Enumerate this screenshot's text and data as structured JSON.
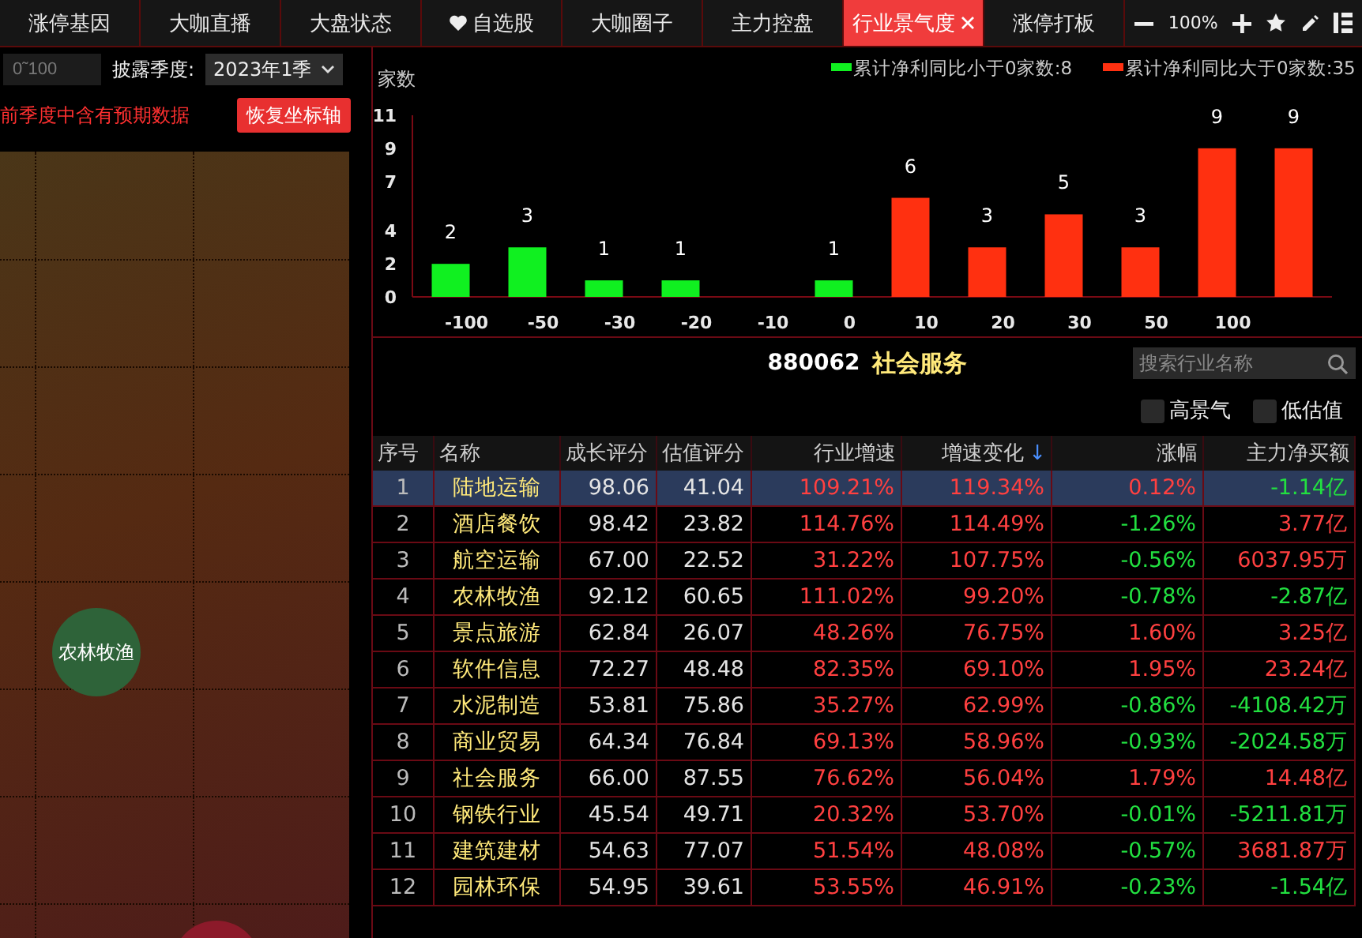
{
  "tabs": [
    {
      "label": "涨停基因",
      "selected": false,
      "kind": "plain",
      "closable": false
    },
    {
      "label": "大咖直播",
      "selected": false,
      "kind": "plain",
      "closable": false
    },
    {
      "label": "大盘状态",
      "selected": false,
      "kind": "plain",
      "closable": false
    },
    {
      "label": "自选股",
      "selected": false,
      "kind": "favorites",
      "closable": false
    },
    {
      "label": "大咖圈子",
      "selected": false,
      "kind": "plain",
      "closable": false
    },
    {
      "label": "主力控盘",
      "selected": false,
      "kind": "plain",
      "closable": false
    },
    {
      "label": "行业景气度",
      "selected": true,
      "kind": "plain",
      "closable": true
    },
    {
      "label": "涨停打板",
      "selected": false,
      "kind": "plain",
      "closable": false
    }
  ],
  "toolbar": {
    "zoom_level": "100%"
  },
  "left_panel": {
    "range_field": {
      "placeholder": "0˜100"
    },
    "quarter_label": "披露季度:",
    "quarter_select": {
      "value": "2023年1季"
    },
    "notice": "前季度中含有预期数据",
    "reset_button": "恢复坐标轴",
    "bubbles": [
      {
        "label": "农林牧渔",
        "color": "#2e6339"
      },
      {
        "color": "#8c1a2a"
      }
    ]
  },
  "chart": {
    "chart_data": {
      "type": "bar",
      "ylabel": "家数",
      "legend": "upper right",
      "data_labels": true,
      "categories": [
        "-100",
        "-50",
        "-30",
        "-20",
        "-10",
        "0",
        "10",
        "20",
        "30",
        "50",
        "100",
        null
      ],
      "ylim": [
        0,
        11
      ],
      "yticks": [
        0,
        2,
        4,
        7,
        9,
        11
      ],
      "series": [
        {
          "name": "累计净利同比小于0家数:8",
          "color": "#10f020",
          "values": [
            2,
            3,
            1,
            1,
            null,
            1,
            null,
            null,
            null,
            null,
            null,
            null
          ]
        },
        {
          "name": "累计净利同比大于0家数:35",
          "color": "#ff3010",
          "values": [
            null,
            null,
            null,
            null,
            null,
            null,
            6,
            3,
            5,
            3,
            9,
            9
          ]
        }
      ]
    }
  },
  "industry": {
    "code": "880062",
    "name": "社会服务"
  },
  "search": {
    "placeholder": "搜索行业名称"
  },
  "filters": [
    {
      "label": "高景气",
      "checked": false
    },
    {
      "label": "低估值",
      "checked": false
    }
  ],
  "table": {
    "columns": [
      {
        "label": "序号"
      },
      {
        "label": "名称"
      },
      {
        "label": "成长评分"
      },
      {
        "label": "估值评分"
      },
      {
        "label": "行业增速"
      },
      {
        "label": "增速变化",
        "sort_arrow": "↓"
      },
      {
        "label": "涨幅"
      },
      {
        "label": "主力净买额"
      }
    ],
    "rows": [
      {
        "rank": "1",
        "name": "陆地运输",
        "growth": "98.06",
        "valuation": "41.04",
        "industry_growth": "109.21%",
        "growth_change": "119.34%",
        "change": {
          "value": "0.12%",
          "up": true
        },
        "net_buy": {
          "value": "-1.14亿",
          "up": false
        },
        "selected": true
      },
      {
        "rank": "2",
        "name": "酒店餐饮",
        "growth": "98.42",
        "valuation": "23.82",
        "industry_growth": "114.76%",
        "growth_change": "114.49%",
        "change": {
          "value": "-1.26%",
          "up": false
        },
        "net_buy": {
          "value": "3.77亿",
          "up": true
        },
        "selected": false
      },
      {
        "rank": "3",
        "name": "航空运输",
        "growth": "67.00",
        "valuation": "22.52",
        "industry_growth": "31.22%",
        "growth_change": "107.75%",
        "change": {
          "value": "-0.56%",
          "up": false
        },
        "net_buy": {
          "value": "6037.95万",
          "up": true
        },
        "selected": false
      },
      {
        "rank": "4",
        "name": "农林牧渔",
        "growth": "92.12",
        "valuation": "60.65",
        "industry_growth": "111.02%",
        "growth_change": "99.20%",
        "change": {
          "value": "-0.78%",
          "up": false
        },
        "net_buy": {
          "value": "-2.87亿",
          "up": false
        },
        "selected": false
      },
      {
        "rank": "5",
        "name": "景点旅游",
        "growth": "62.84",
        "valuation": "26.07",
        "industry_growth": "48.26%",
        "growth_change": "76.75%",
        "change": {
          "value": "1.60%",
          "up": true
        },
        "net_buy": {
          "value": "3.25亿",
          "up": true
        },
        "selected": false
      },
      {
        "rank": "6",
        "name": "软件信息",
        "growth": "72.27",
        "valuation": "48.48",
        "industry_growth": "82.35%",
        "growth_change": "69.10%",
        "change": {
          "value": "1.95%",
          "up": true
        },
        "net_buy": {
          "value": "23.24亿",
          "up": true
        },
        "selected": false
      },
      {
        "rank": "7",
        "name": "水泥制造",
        "growth": "53.81",
        "valuation": "75.86",
        "industry_growth": "35.27%",
        "growth_change": "62.99%",
        "change": {
          "value": "-0.86%",
          "up": false
        },
        "net_buy": {
          "value": "-4108.42万",
          "up": false
        },
        "selected": false
      },
      {
        "rank": "8",
        "name": "商业贸易",
        "growth": "64.34",
        "valuation": "76.84",
        "industry_growth": "69.13%",
        "growth_change": "58.96%",
        "change": {
          "value": "-0.93%",
          "up": false
        },
        "net_buy": {
          "value": "-2024.58万",
          "up": false
        },
        "selected": false
      },
      {
        "rank": "9",
        "name": "社会服务",
        "growth": "66.00",
        "valuation": "87.55",
        "industry_growth": "76.62%",
        "growth_change": "56.04%",
        "change": {
          "value": "1.79%",
          "up": true
        },
        "net_buy": {
          "value": "14.48亿",
          "up": true
        },
        "selected": false
      },
      {
        "rank": "10",
        "name": "钢铁行业",
        "growth": "45.54",
        "valuation": "49.71",
        "industry_growth": "20.32%",
        "growth_change": "53.70%",
        "change": {
          "value": "-0.01%",
          "up": false
        },
        "net_buy": {
          "value": "-5211.81万",
          "up": false
        },
        "selected": false
      },
      {
        "rank": "11",
        "name": "建筑建材",
        "growth": "54.63",
        "valuation": "77.07",
        "industry_growth": "51.54%",
        "growth_change": "48.08%",
        "change": {
          "value": "-0.57%",
          "up": false
        },
        "net_buy": {
          "value": "3681.87万",
          "up": true
        },
        "selected": false
      },
      {
        "rank": "12",
        "name": "园林环保",
        "growth": "54.95",
        "valuation": "39.61",
        "industry_growth": "53.55%",
        "growth_change": "46.91%",
        "change": {
          "value": "-0.23%",
          "up": false
        },
        "net_buy": {
          "value": "-1.54亿",
          "up": false
        },
        "selected": false
      }
    ]
  }
}
